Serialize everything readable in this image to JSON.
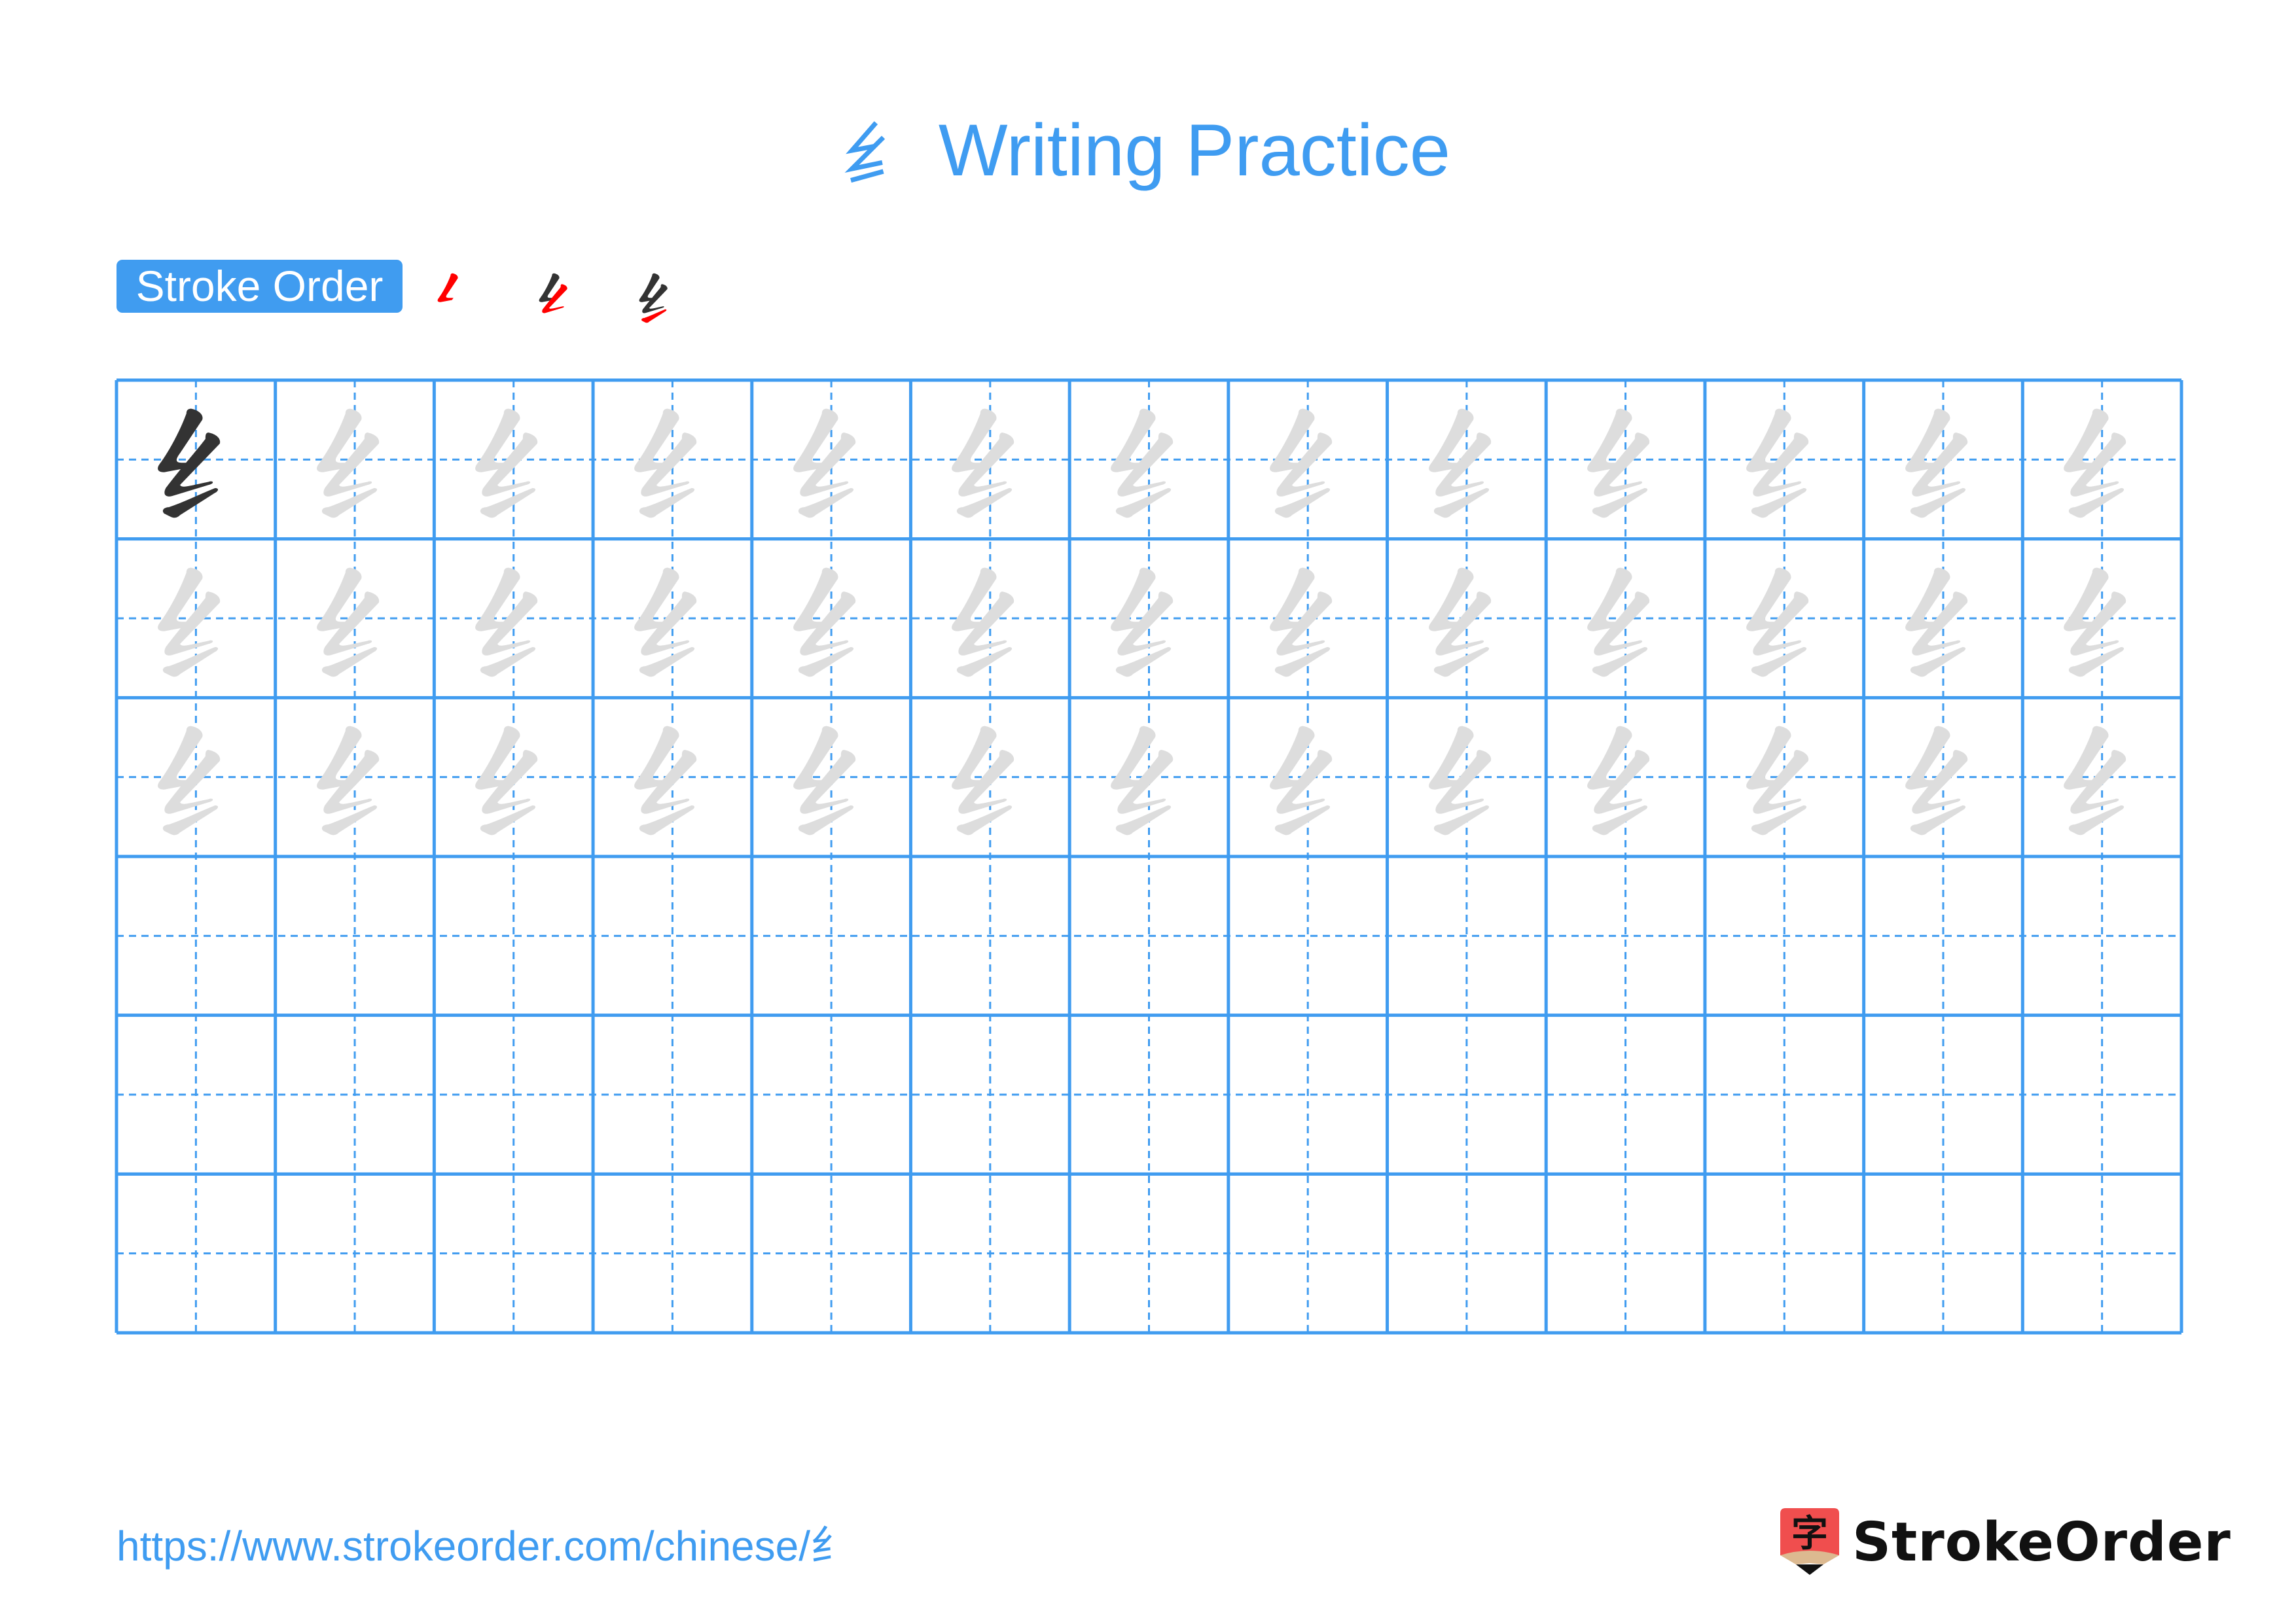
{
  "page": {
    "title": {
      "character": "纟",
      "text": "Writing Practice"
    },
    "stroke_order": {
      "label": "Stroke Order",
      "stroke_count": 3,
      "steps": [
        {
          "step": 1,
          "highlight_stroke": 1
        },
        {
          "step": 2,
          "highlight_stroke": 2
        },
        {
          "step": 3,
          "highlight_stroke": 3
        }
      ]
    },
    "grid": {
      "columns": 13,
      "rows": 6,
      "character": "纟",
      "model_cells": 1,
      "trace_rows": 3,
      "empty_rows": 3
    },
    "footer": {
      "url": "https://www.strokeorder.com/chinese/纟",
      "logo_text": "StrokeOrder",
      "logo_icon_char": "字"
    },
    "colors": {
      "accent": "#409cf0",
      "grid_line": "#409cf0",
      "model_char": "#333333",
      "trace_char": "#dddddd",
      "highlight_stroke": "#ff0000",
      "logo_red": "#f04e4e",
      "logo_tan": "#dcb990"
    }
  }
}
